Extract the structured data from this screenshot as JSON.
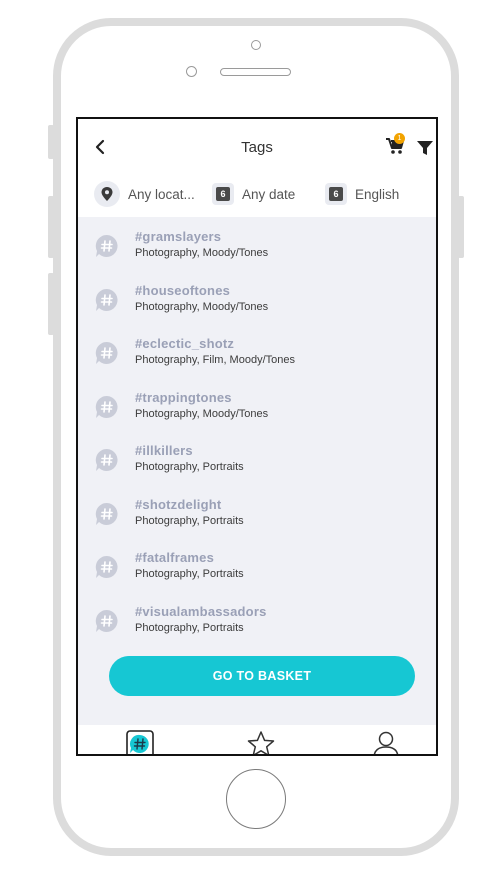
{
  "header": {
    "title": "Tags",
    "cart_badge": "1"
  },
  "filters": {
    "location": "Any locat...",
    "date_icon_text": "6",
    "date": "Any date",
    "language_icon_text": "6",
    "language": "English"
  },
  "tags": [
    {
      "name": "#gramslayers",
      "categories": "Photography, Moody/Tones"
    },
    {
      "name": "#houseoftones",
      "categories": "Photography, Moody/Tones"
    },
    {
      "name": "#eclectic_shotz",
      "categories": "Photography, Film, Moody/Tones"
    },
    {
      "name": "#trappingtones",
      "categories": "Photography, Moody/Tones"
    },
    {
      "name": "#illkillers",
      "categories": "Photography, Portraits"
    },
    {
      "name": "#shotzdelight",
      "categories": "Photography, Portraits"
    },
    {
      "name": "#fatalframes",
      "categories": "Photography, Portraits"
    },
    {
      "name": "#visualambassadors",
      "categories": "Photography, Portraits"
    }
  ],
  "basket": {
    "label": "GO TO BASKET"
  },
  "colors": {
    "accent": "#16c7d3",
    "list_background": "#f0f1f6",
    "tag_text": "#9aa0b6",
    "badge": "#f2a300"
  },
  "icons": {
    "back": "chevron-left-icon",
    "cart": "cart-icon",
    "filter": "filter-icon",
    "location": "location-pin-icon",
    "calendar": "calendar-icon",
    "tag": "hashtag-bubble-icon",
    "tab_tags": "hashtag-tab-icon",
    "tab_favorites": "star-icon",
    "tab_profile": "user-icon"
  }
}
